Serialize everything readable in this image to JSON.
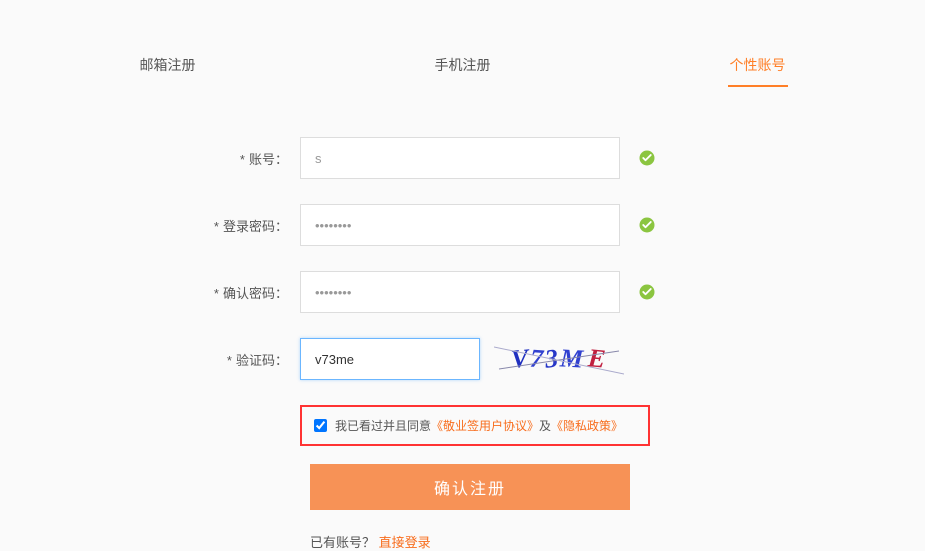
{
  "tabs": {
    "email": "邮箱注册",
    "phone": "手机注册",
    "personal": "个性账号"
  },
  "labels": {
    "account": "账号：",
    "password": "登录密码：",
    "confirmPassword": "确认密码：",
    "captcha": "验证码："
  },
  "values": {
    "account": "s",
    "password": "••••••••",
    "confirmPassword": "••••••••",
    "captcha": "v73me"
  },
  "captchaText": "V73ME",
  "agreement": {
    "prefix": "我已看过并且同意",
    "userAgreement": "《敬业签用户协议》",
    "and": " 及",
    "privacy": "《隐私政策》"
  },
  "submitLabel": "确认注册",
  "bottom": {
    "hasAccount": "已有账号？",
    "login": "直接登录"
  }
}
